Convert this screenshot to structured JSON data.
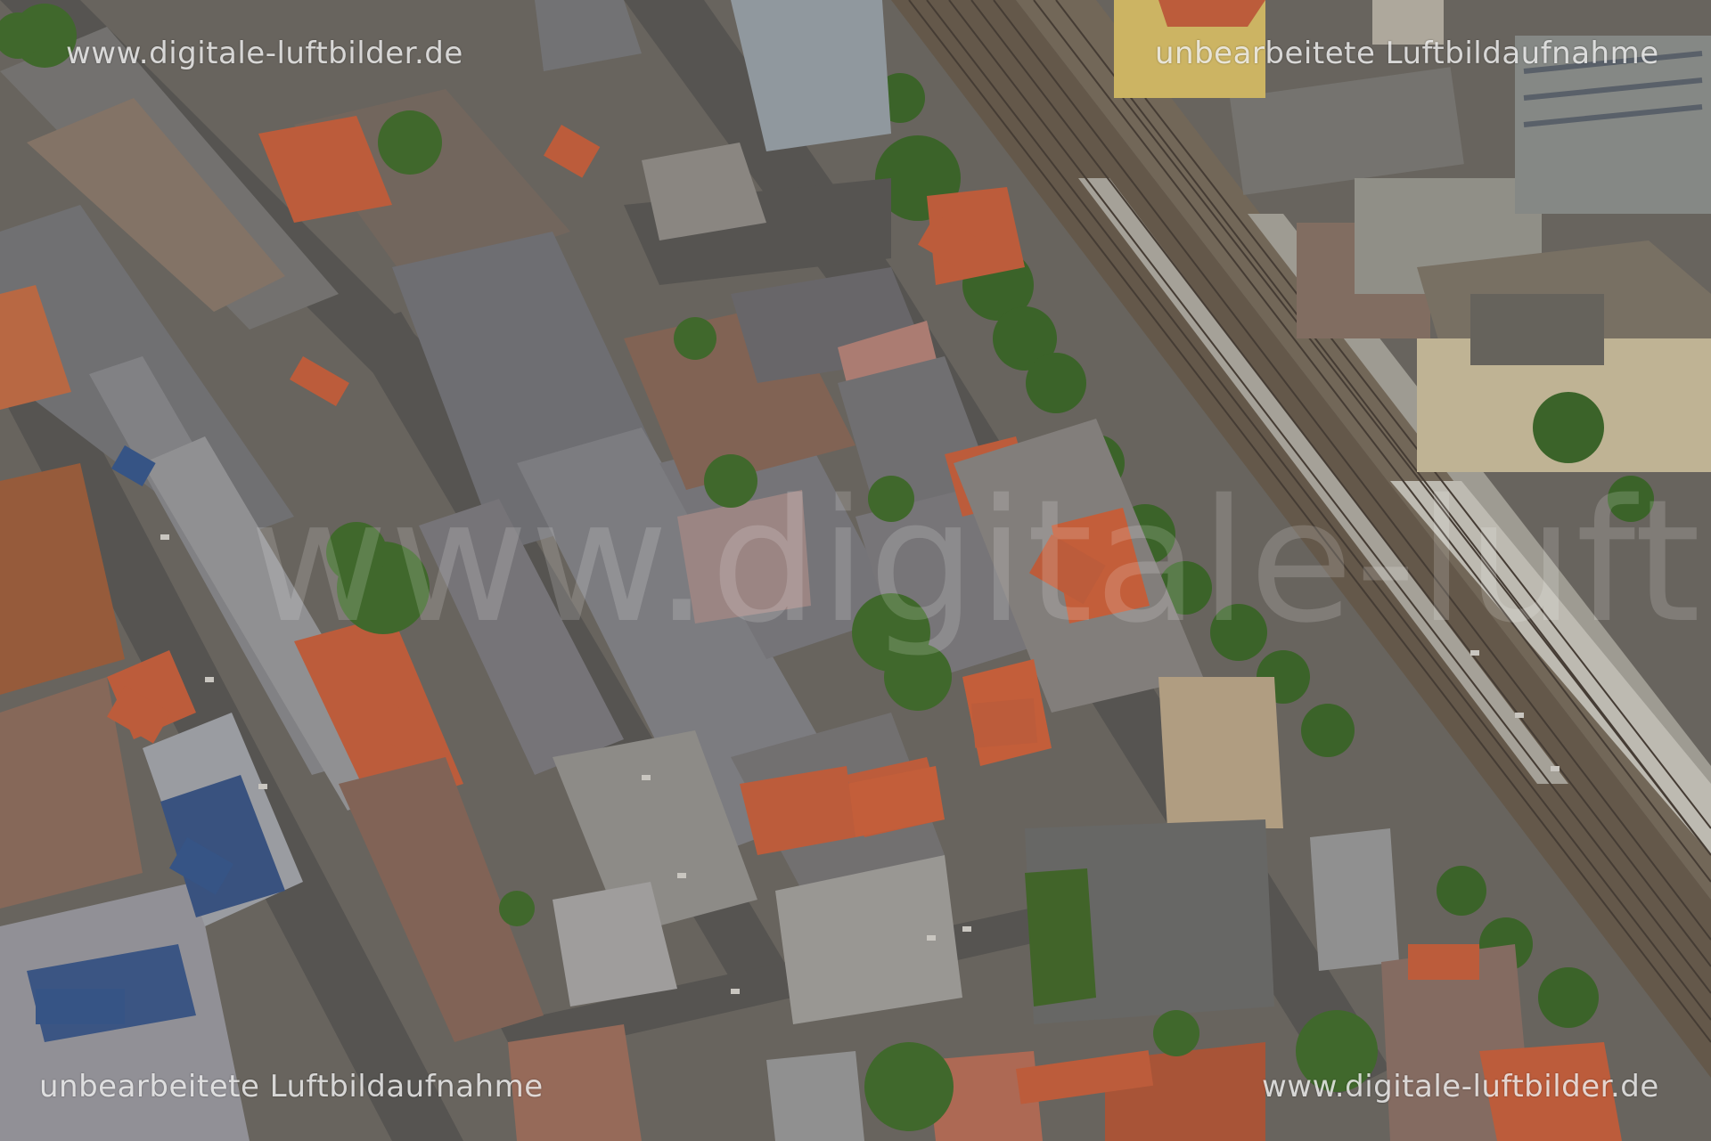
{
  "watermarks": {
    "top_left": "www.digitale-luftbilder.de",
    "top_right": "unbearbeitete Luftbildaufnahme",
    "bottom_left": "unbearbeitete Luftbildaufnahme",
    "bottom_right": "www.digitale-luftbilder.de",
    "center": "www.digitale-luftbilder.de"
  },
  "colors": {
    "roof_red": "#c8623f",
    "roof_slate": "#77777a",
    "street": "#5c5a57",
    "tree": "#3f6a2c",
    "rail": "#6b5e4f",
    "platform": "#a8a59c"
  }
}
